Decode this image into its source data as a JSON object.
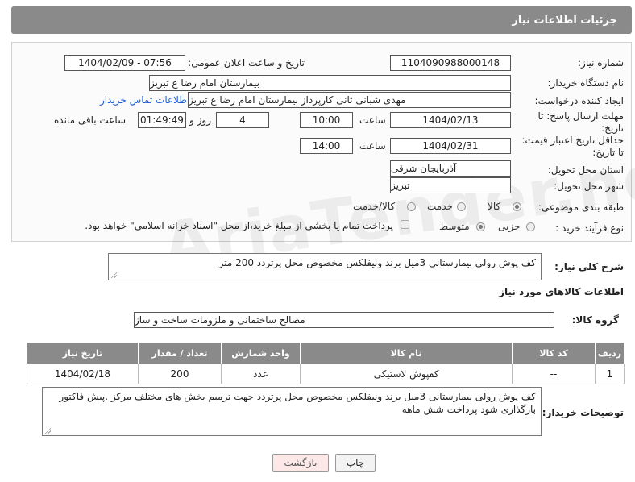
{
  "header": {
    "title": "جزئیات اطلاعات نیاز"
  },
  "form": {
    "need_number_label": "شماره نیاز:",
    "need_number": "1104090988000148",
    "announce_label": "تاریخ و ساعت اعلان عمومی:",
    "announce_value": "1404/02/09 - 07:56",
    "buyer_org_label": "نام دستگاه خریدار:",
    "buyer_org": "بیمارستان امام رضا  ع  تبریز",
    "creator_label": "ایجاد کننده درخواست:",
    "creator": "مهدی شبانی ثانی کارپرداز بیمارستان امام رضا  ع  تبریز",
    "contact_link": "اطلاعات تماس خریدار",
    "deadline_label": "مهلت ارسال پاسخ: تا تاریخ:",
    "deadline_date": "1404/02/13",
    "hour_label": "ساعت",
    "deadline_time": "10:00",
    "days_value": "4",
    "days_label": "روز و",
    "remaining_time": "01:49:49",
    "remaining_label": "ساعت باقی مانده",
    "validity_label": "حداقل تاریخ اعتبار قیمت: تا تاریخ:",
    "validity_date": "1404/02/31",
    "validity_time": "14:00",
    "province_label": "استان محل تحویل:",
    "province": "آذربایجان شرقی",
    "city_label": "شهر محل تحویل:",
    "city": "تبریز",
    "category_label": "طبقه بندی موضوعی:",
    "category_options": [
      "کالا",
      "خدمت",
      "کالا/خدمت"
    ],
    "process_label": "نوع فرآیند خرید :",
    "process_options": [
      "جزیی",
      "متوسط"
    ],
    "payment_note": "پرداخت تمام یا بخشی از مبلغ خرید،از محل \"اسناد خزانه اسلامی\" خواهد بود."
  },
  "summary": {
    "label": "شرح کلی نیاز:",
    "text": "کف پوش رولی بیمارستانی 3میل برند ونیفلکس مخصوص محل پرتردد 200 متر"
  },
  "goods": {
    "section_title": "اطلاعات کالاهای مورد نیاز",
    "group_label": "گروه کالا:",
    "group_value": "مصالح ساختمانی و ملزومات ساخت و ساز",
    "columns": [
      "ردیف",
      "کد کالا",
      "نام کالا",
      "واحد شمارش",
      "تعداد / مقدار",
      "تاریخ نیاز"
    ],
    "rows": [
      [
        "1",
        "--",
        "کفپوش لاستیکی",
        "عدد",
        "200",
        "1404/02/18"
      ]
    ]
  },
  "buyer_notes": {
    "label": "توضیحات خریدار:",
    "line1": "کف پوش رولی بیمارستانی 3میل برند ونیفلکس مخصوص محل پرتردد جهت ترمیم بخش های مختلف مرکز .پیش فاکتور",
    "line2": "بارگذاری شود پرداخت شش ماهه"
  },
  "buttons": {
    "print": "چاپ",
    "back": "بازگشت"
  },
  "watermark": "AriaTender.net",
  "colors": {
    "header_bg": "#8a8a8a",
    "link": "#1a5bd6",
    "back_button_bg": "#fde8e8"
  }
}
